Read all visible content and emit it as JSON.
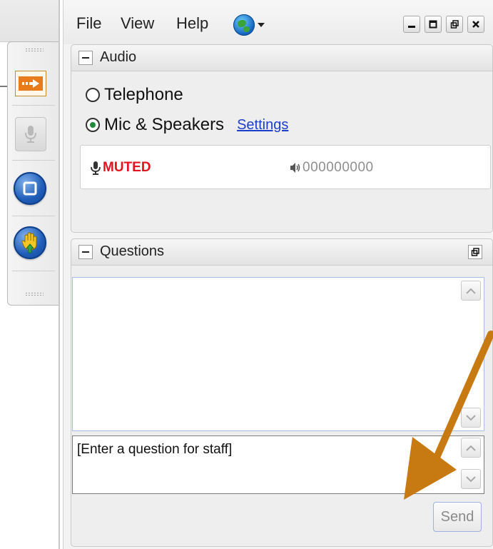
{
  "menubar": {
    "items": [
      "File",
      "View",
      "Help"
    ],
    "language_icon": "globe-icon"
  },
  "window_controls": [
    "minimize-icon",
    "maximize-icon",
    "restore-icon",
    "close-icon"
  ],
  "audio": {
    "title": "Audio",
    "options": [
      {
        "label": "Telephone",
        "selected": false
      },
      {
        "label": "Mic & Speakers",
        "selected": true
      }
    ],
    "settings_link": "Settings",
    "status": "MUTED",
    "level_display": "000000000"
  },
  "questions": {
    "title": "Questions",
    "input_placeholder": "[Enter a question for staff]",
    "send_label": "Send"
  },
  "toolbar": {
    "buttons": [
      "arrow-icon",
      "microphone-icon",
      "stop-icon",
      "raise-hand-icon"
    ]
  },
  "colors": {
    "accent_orange": "#e87b1c",
    "muted_red": "#e0141e",
    "link_blue": "#1a3fcc",
    "annotation_arrow": "#c87a12"
  }
}
